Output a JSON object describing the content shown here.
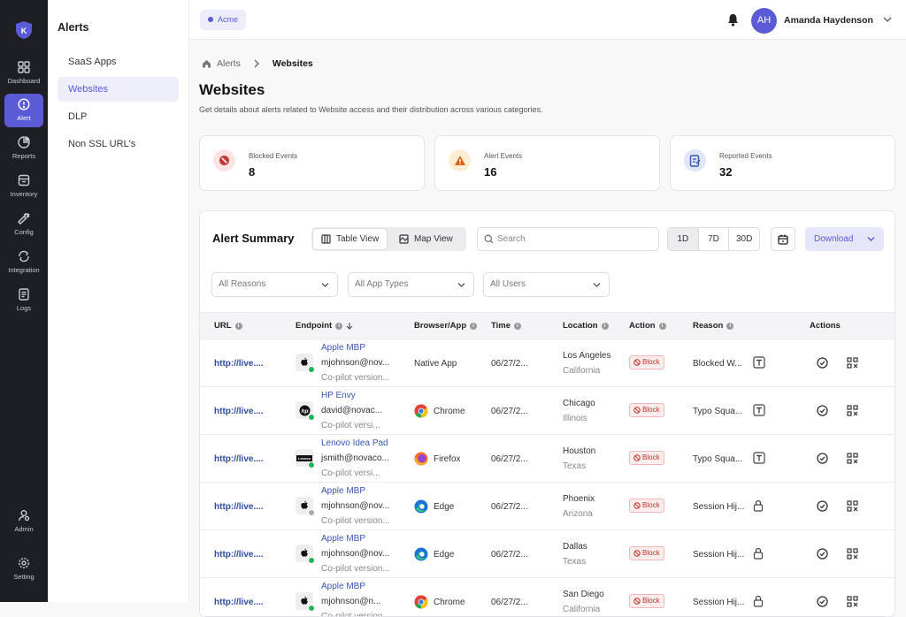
{
  "rail": {
    "items": [
      {
        "label": "Dashboard",
        "icon": "grid-icon"
      },
      {
        "label": "Alert",
        "icon": "alert-icon"
      },
      {
        "label": "Reports",
        "icon": "pie-chart-icon"
      },
      {
        "label": "Inventory",
        "icon": "inventory-icon"
      },
      {
        "label": "Config",
        "icon": "wrench-icon"
      },
      {
        "label": "Integration",
        "icon": "integration-icon"
      },
      {
        "label": "Logs",
        "icon": "logs-icon"
      },
      {
        "label": "Admin",
        "icon": "admin-icon"
      },
      {
        "label": "Setting",
        "icon": "gear-icon"
      }
    ]
  },
  "subnav": {
    "title": "Alerts",
    "items": [
      "SaaS Apps",
      "Websites",
      "DLP",
      "Non SSL URL's"
    ]
  },
  "topbar": {
    "org": "Acme",
    "avatar_initials": "AH",
    "user_name": "Amanda Haydenson"
  },
  "breadcrumb": {
    "parent": "Alerts",
    "current": "Websites"
  },
  "page": {
    "title": "Websites",
    "description": "Get details about alerts related to Website access and their distribution across various categories."
  },
  "cards": [
    {
      "label": "Blocked Events",
      "value": "8"
    },
    {
      "label": "Alert Events",
      "value": "16"
    },
    {
      "label": "Reported Events",
      "value": "32"
    }
  ],
  "summary": {
    "title": "Alert Summary",
    "table_view": "Table View",
    "map_view": "Map View",
    "search_placeholder": "Search",
    "ranges": [
      "1D",
      "7D",
      "30D"
    ],
    "download": "Download",
    "filters": [
      "All Reasons",
      "All App Types",
      "All Users"
    ]
  },
  "table": {
    "headers": {
      "url": "URL",
      "endpoint": "Endpoint",
      "browser": "Browser/App",
      "time": "Time",
      "location": "Location",
      "action": "Action",
      "reason": "Reason",
      "actions": "Actions"
    },
    "rows": [
      {
        "url": "http://live....",
        "device": "Apple MBP",
        "email": "mjohnson@nov...",
        "version": "Co-pilot version...",
        "browser": "Native App",
        "time": "06/27/2...",
        "city": "Los Angeles",
        "state": "California",
        "action": "Block",
        "reason": "Blocked W..."
      },
      {
        "url": "http://live....",
        "device": "HP Envy",
        "email": "david@novac...",
        "version": "Co-pilot versi...",
        "browser": "Chrome",
        "time": "06/27/2...",
        "city": "Chicago",
        "state": "Illinois",
        "action": "Block",
        "reason": "Typo Squa..."
      },
      {
        "url": "http://live....",
        "device": "Lenovo Idea Pad",
        "email": "jsmith@novaco...",
        "version": "Co-pilot versi...",
        "browser": "Firefox",
        "time": "06/27/2...",
        "city": "Houston",
        "state": "Texas",
        "action": "Block",
        "reason": "Typo Squa..."
      },
      {
        "url": "http://live....",
        "device": "Apple MBP",
        "email": "mjohnson@nov...",
        "version": "Co-pilot version...",
        "browser": "Edge",
        "time": "06/27/2...",
        "city": "Phoenix",
        "state": "Arizona",
        "action": "Block",
        "reason": "Session Hij..."
      },
      {
        "url": "http://live....",
        "device": "Apple MBP",
        "email": "mjohnson@nov...",
        "version": "Co-pilot version...",
        "browser": "Edge",
        "time": "06/27/2...",
        "city": "Dallas",
        "state": "Texas",
        "action": "Block",
        "reason": "Session Hij..."
      },
      {
        "url": "http://live....",
        "device": "Apple MBP",
        "email": "mjohnson@n...",
        "version": "Co-pilot version...",
        "browser": "Chrome",
        "time": "06/27/2...",
        "city": "San Diego",
        "state": "California",
        "action": "Block",
        "reason": "Session Hij..."
      }
    ]
  }
}
